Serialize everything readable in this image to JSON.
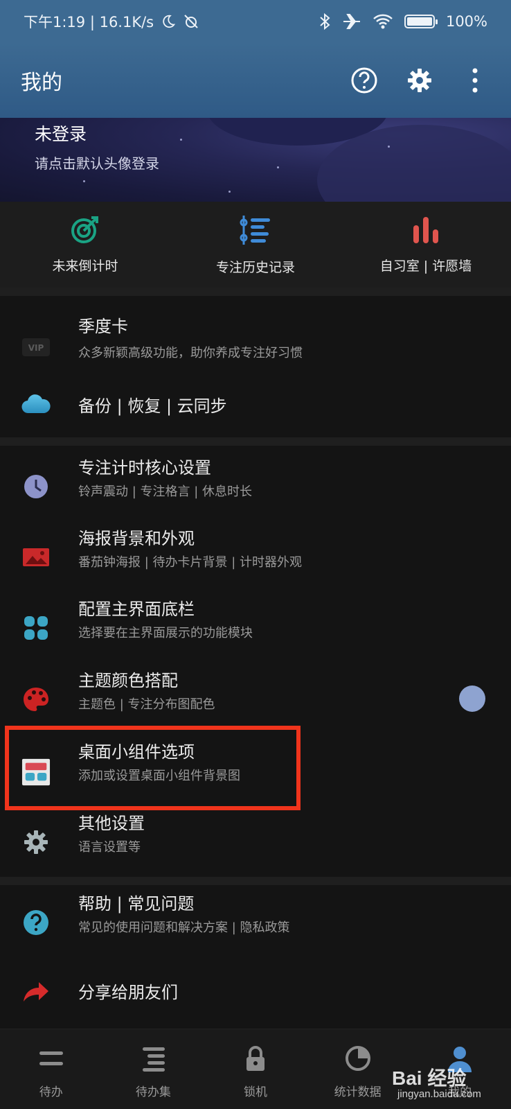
{
  "status_bar": {
    "time_speed": "下午1:19 | 16.1K/s",
    "battery": "100%"
  },
  "app_bar": {
    "title": "我的",
    "icons": [
      "help-icon",
      "settings-icon",
      "more-icon"
    ]
  },
  "login_banner": {
    "title": "未登录",
    "subtitle": "请点击默认头像登录"
  },
  "quick_actions": [
    {
      "label": "未来倒计时",
      "icon": "target-icon",
      "color": "#1aa384"
    },
    {
      "label": "专注历史记录",
      "icon": "timeline-list-icon",
      "color": "#3f8bd8"
    },
    {
      "label": "自习室 | 许愿墙",
      "icon": "bar-chart-icon",
      "color": "#e0554e"
    }
  ],
  "section1": [
    {
      "title": "季度卡",
      "subtitle": "众多新颖高级功能，助你养成专注好习惯",
      "icon": "vip-icon"
    },
    {
      "title": "备份 | 恢复 | 云同步",
      "subtitle": "",
      "icon": "cloud-icon"
    }
  ],
  "section2": [
    {
      "title": "专注计时核心设置",
      "subtitle": "铃声震动 | 专注格言 | 休息时长",
      "icon": "clock-icon"
    },
    {
      "title": "海报背景和外观",
      "subtitle": "番茄钟海报 | 待办卡片背景 | 计时器外观",
      "icon": "image-icon"
    },
    {
      "title": "配置主界面底栏",
      "subtitle": "选择要在主界面展示的功能模块",
      "icon": "grid-icon"
    },
    {
      "title": "主题颜色搭配",
      "subtitle": "主题色 | 专注分布图配色",
      "icon": "palette-icon"
    },
    {
      "title": "桌面小组件选项",
      "subtitle": "添加或设置桌面小组件背景图",
      "icon": "widget-icon"
    },
    {
      "title": "其他设置",
      "subtitle": "语言设置等",
      "icon": "gear-icon"
    }
  ],
  "section3": [
    {
      "title": "帮助 | 常见问题",
      "subtitle": "常见的使用问题和解决方案 | 隐私政策",
      "icon": "question-icon"
    },
    {
      "title": "分享给朋友们",
      "subtitle": "",
      "icon": "share-icon"
    }
  ],
  "bottom_nav": [
    {
      "label": "待办",
      "icon": "todo-icon"
    },
    {
      "label": "待办集",
      "icon": "todo-set-icon"
    },
    {
      "label": "锁机",
      "icon": "lock-icon"
    },
    {
      "label": "统计数据",
      "icon": "pie-chart-icon"
    },
    {
      "label": "我的",
      "icon": "person-icon"
    }
  ],
  "watermark": {
    "brand": "Bai 经验",
    "url": "jingyan.baidu.com"
  },
  "colors": {
    "appbar": "#3d6a92",
    "highlight_box": "#f0341c",
    "background": "#141414"
  }
}
